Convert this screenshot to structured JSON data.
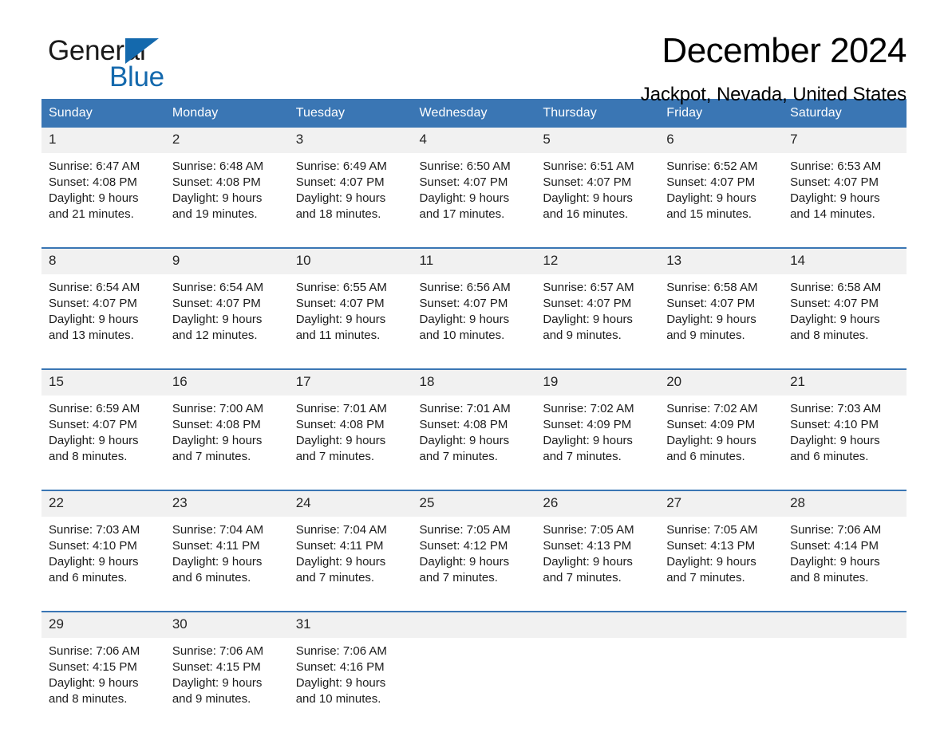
{
  "brand": {
    "name_part1": "General",
    "name_part2": "Blue",
    "accent_color": "#1469ad",
    "logo_icon": "triangle-icon"
  },
  "header": {
    "title": "December 2024",
    "subtitle": "Jackpot, Nevada, United States"
  },
  "theme": {
    "header_blue": "#3a76b4",
    "day_band_gray": "#f1f1f1",
    "text_color": "#1c1c1c"
  },
  "weekdays": [
    "Sunday",
    "Monday",
    "Tuesday",
    "Wednesday",
    "Thursday",
    "Friday",
    "Saturday"
  ],
  "weeks": [
    {
      "days": [
        {
          "num": "1",
          "sunrise": "Sunrise: 6:47 AM",
          "sunset": "Sunset: 4:08 PM",
          "daylight1": "Daylight: 9 hours",
          "daylight2": "and 21 minutes."
        },
        {
          "num": "2",
          "sunrise": "Sunrise: 6:48 AM",
          "sunset": "Sunset: 4:08 PM",
          "daylight1": "Daylight: 9 hours",
          "daylight2": "and 19 minutes."
        },
        {
          "num": "3",
          "sunrise": "Sunrise: 6:49 AM",
          "sunset": "Sunset: 4:07 PM",
          "daylight1": "Daylight: 9 hours",
          "daylight2": "and 18 minutes."
        },
        {
          "num": "4",
          "sunrise": "Sunrise: 6:50 AM",
          "sunset": "Sunset: 4:07 PM",
          "daylight1": "Daylight: 9 hours",
          "daylight2": "and 17 minutes."
        },
        {
          "num": "5",
          "sunrise": "Sunrise: 6:51 AM",
          "sunset": "Sunset: 4:07 PM",
          "daylight1": "Daylight: 9 hours",
          "daylight2": "and 16 minutes."
        },
        {
          "num": "6",
          "sunrise": "Sunrise: 6:52 AM",
          "sunset": "Sunset: 4:07 PM",
          "daylight1": "Daylight: 9 hours",
          "daylight2": "and 15 minutes."
        },
        {
          "num": "7",
          "sunrise": "Sunrise: 6:53 AM",
          "sunset": "Sunset: 4:07 PM",
          "daylight1": "Daylight: 9 hours",
          "daylight2": "and 14 minutes."
        }
      ]
    },
    {
      "days": [
        {
          "num": "8",
          "sunrise": "Sunrise: 6:54 AM",
          "sunset": "Sunset: 4:07 PM",
          "daylight1": "Daylight: 9 hours",
          "daylight2": "and 13 minutes."
        },
        {
          "num": "9",
          "sunrise": "Sunrise: 6:54 AM",
          "sunset": "Sunset: 4:07 PM",
          "daylight1": "Daylight: 9 hours",
          "daylight2": "and 12 minutes."
        },
        {
          "num": "10",
          "sunrise": "Sunrise: 6:55 AM",
          "sunset": "Sunset: 4:07 PM",
          "daylight1": "Daylight: 9 hours",
          "daylight2": "and 11 minutes."
        },
        {
          "num": "11",
          "sunrise": "Sunrise: 6:56 AM",
          "sunset": "Sunset: 4:07 PM",
          "daylight1": "Daylight: 9 hours",
          "daylight2": "and 10 minutes."
        },
        {
          "num": "12",
          "sunrise": "Sunrise: 6:57 AM",
          "sunset": "Sunset: 4:07 PM",
          "daylight1": "Daylight: 9 hours",
          "daylight2": "and 9 minutes."
        },
        {
          "num": "13",
          "sunrise": "Sunrise: 6:58 AM",
          "sunset": "Sunset: 4:07 PM",
          "daylight1": "Daylight: 9 hours",
          "daylight2": "and 9 minutes."
        },
        {
          "num": "14",
          "sunrise": "Sunrise: 6:58 AM",
          "sunset": "Sunset: 4:07 PM",
          "daylight1": "Daylight: 9 hours",
          "daylight2": "and 8 minutes."
        }
      ]
    },
    {
      "days": [
        {
          "num": "15",
          "sunrise": "Sunrise: 6:59 AM",
          "sunset": "Sunset: 4:07 PM",
          "daylight1": "Daylight: 9 hours",
          "daylight2": "and 8 minutes."
        },
        {
          "num": "16",
          "sunrise": "Sunrise: 7:00 AM",
          "sunset": "Sunset: 4:08 PM",
          "daylight1": "Daylight: 9 hours",
          "daylight2": "and 7 minutes."
        },
        {
          "num": "17",
          "sunrise": "Sunrise: 7:01 AM",
          "sunset": "Sunset: 4:08 PM",
          "daylight1": "Daylight: 9 hours",
          "daylight2": "and 7 minutes."
        },
        {
          "num": "18",
          "sunrise": "Sunrise: 7:01 AM",
          "sunset": "Sunset: 4:08 PM",
          "daylight1": "Daylight: 9 hours",
          "daylight2": "and 7 minutes."
        },
        {
          "num": "19",
          "sunrise": "Sunrise: 7:02 AM",
          "sunset": "Sunset: 4:09 PM",
          "daylight1": "Daylight: 9 hours",
          "daylight2": "and 7 minutes."
        },
        {
          "num": "20",
          "sunrise": "Sunrise: 7:02 AM",
          "sunset": "Sunset: 4:09 PM",
          "daylight1": "Daylight: 9 hours",
          "daylight2": "and 6 minutes."
        },
        {
          "num": "21",
          "sunrise": "Sunrise: 7:03 AM",
          "sunset": "Sunset: 4:10 PM",
          "daylight1": "Daylight: 9 hours",
          "daylight2": "and 6 minutes."
        }
      ]
    },
    {
      "days": [
        {
          "num": "22",
          "sunrise": "Sunrise: 7:03 AM",
          "sunset": "Sunset: 4:10 PM",
          "daylight1": "Daylight: 9 hours",
          "daylight2": "and 6 minutes."
        },
        {
          "num": "23",
          "sunrise": "Sunrise: 7:04 AM",
          "sunset": "Sunset: 4:11 PM",
          "daylight1": "Daylight: 9 hours",
          "daylight2": "and 6 minutes."
        },
        {
          "num": "24",
          "sunrise": "Sunrise: 7:04 AM",
          "sunset": "Sunset: 4:11 PM",
          "daylight1": "Daylight: 9 hours",
          "daylight2": "and 7 minutes."
        },
        {
          "num": "25",
          "sunrise": "Sunrise: 7:05 AM",
          "sunset": "Sunset: 4:12 PM",
          "daylight1": "Daylight: 9 hours",
          "daylight2": "and 7 minutes."
        },
        {
          "num": "26",
          "sunrise": "Sunrise: 7:05 AM",
          "sunset": "Sunset: 4:13 PM",
          "daylight1": "Daylight: 9 hours",
          "daylight2": "and 7 minutes."
        },
        {
          "num": "27",
          "sunrise": "Sunrise: 7:05 AM",
          "sunset": "Sunset: 4:13 PM",
          "daylight1": "Daylight: 9 hours",
          "daylight2": "and 7 minutes."
        },
        {
          "num": "28",
          "sunrise": "Sunrise: 7:06 AM",
          "sunset": "Sunset: 4:14 PM",
          "daylight1": "Daylight: 9 hours",
          "daylight2": "and 8 minutes."
        }
      ]
    },
    {
      "days": [
        {
          "num": "29",
          "sunrise": "Sunrise: 7:06 AM",
          "sunset": "Sunset: 4:15 PM",
          "daylight1": "Daylight: 9 hours",
          "daylight2": "and 8 minutes."
        },
        {
          "num": "30",
          "sunrise": "Sunrise: 7:06 AM",
          "sunset": "Sunset: 4:15 PM",
          "daylight1": "Daylight: 9 hours",
          "daylight2": "and 9 minutes."
        },
        {
          "num": "31",
          "sunrise": "Sunrise: 7:06 AM",
          "sunset": "Sunset: 4:16 PM",
          "daylight1": "Daylight: 9 hours",
          "daylight2": "and 10 minutes."
        },
        {
          "num": "",
          "sunrise": "",
          "sunset": "",
          "daylight1": "",
          "daylight2": ""
        },
        {
          "num": "",
          "sunrise": "",
          "sunset": "",
          "daylight1": "",
          "daylight2": ""
        },
        {
          "num": "",
          "sunrise": "",
          "sunset": "",
          "daylight1": "",
          "daylight2": ""
        },
        {
          "num": "",
          "sunrise": "",
          "sunset": "",
          "daylight1": "",
          "daylight2": ""
        }
      ]
    }
  ]
}
